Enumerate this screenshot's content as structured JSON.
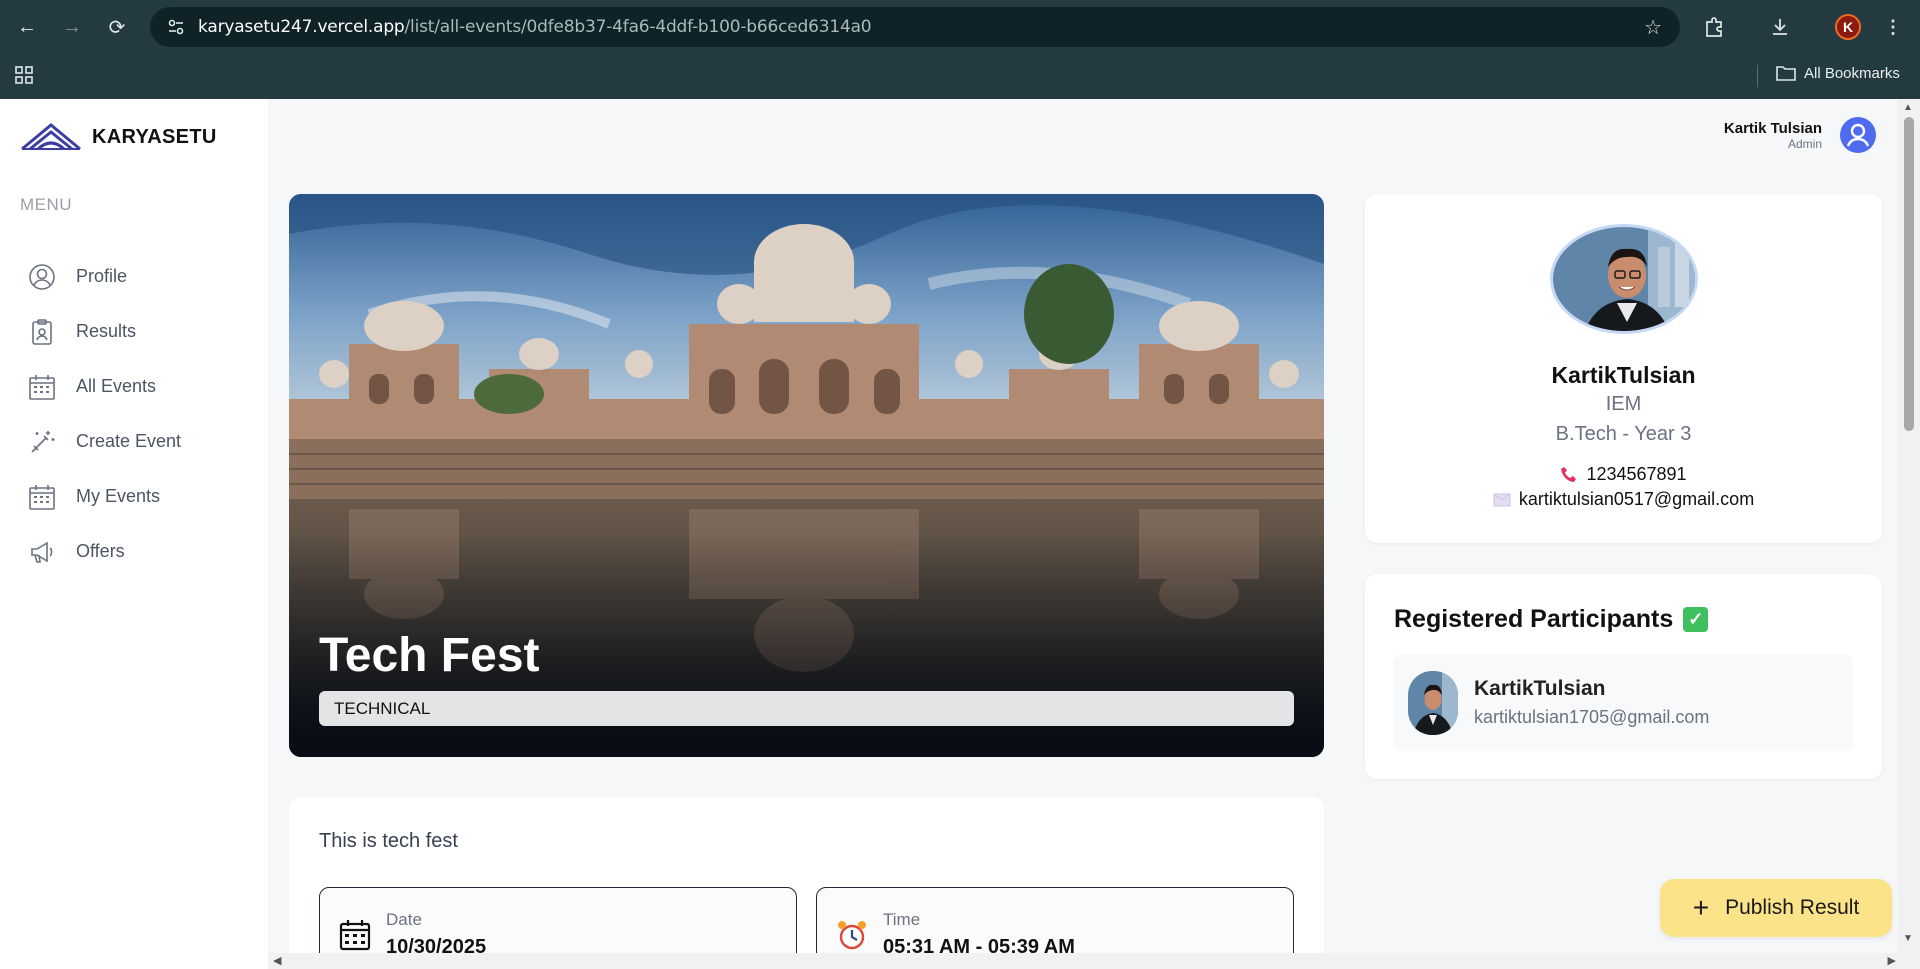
{
  "browser": {
    "url_domain": "karyasetu247.vercel.app",
    "url_path": "/list/all-events/0dfe8b37-4fa6-4ddf-b100-b66ced6314a0",
    "bookmarks_label": "All Bookmarks",
    "profile_initial": "K"
  },
  "sidebar": {
    "brand": "KARYASETU",
    "menu_label": "MENU",
    "items": [
      {
        "label": "Profile",
        "icon": "user-circle-icon"
      },
      {
        "label": "Results",
        "icon": "clipboard-icon"
      },
      {
        "label": "All Events",
        "icon": "calendar-icon"
      },
      {
        "label": "Create Event",
        "icon": "magic-wand-icon"
      },
      {
        "label": "My Events",
        "icon": "calendar-icon"
      },
      {
        "label": "Offers",
        "icon": "megaphone-icon"
      }
    ]
  },
  "header": {
    "user_name": "Kartik Tulsian",
    "user_role": "Admin"
  },
  "event": {
    "title": "Tech Fest",
    "category": "TECHNICAL",
    "description": "This is tech fest",
    "date_label": "Date",
    "date_value": "10/30/2025",
    "time_label": "Time",
    "time_value": "05:31 AM - 05:39 AM"
  },
  "organizer": {
    "name": "KartikTulsian",
    "institute": "IEM",
    "year": "B.Tech - Year 3",
    "phone": "1234567891",
    "email": "kartiktulsian0517@gmail.com"
  },
  "participants": {
    "title": "Registered Participants",
    "list": [
      {
        "name": "KartikTulsian",
        "email": "kartiktulsian1705@gmail.com"
      }
    ]
  },
  "actions": {
    "publish_label": "Publish Result"
  }
}
